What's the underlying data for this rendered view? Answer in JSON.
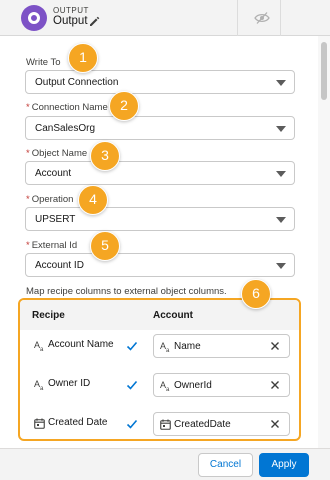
{
  "header": {
    "subtitle": "OUTPUT",
    "title": "Output",
    "icons": [
      "output-node-icon",
      "pencil-icon",
      "eye-hidden-icon"
    ]
  },
  "form": {
    "write_to": {
      "label": "Write To",
      "value": "Output Connection",
      "required": false
    },
    "connection_name": {
      "label": "Connection Name",
      "value": "CanSalesOrg",
      "required": true
    },
    "object_name": {
      "label": "Object Name",
      "value": "Account",
      "required": true
    },
    "operation": {
      "label": "Operation",
      "value": "UPSERT",
      "required": true
    },
    "external_id": {
      "label": "External Id",
      "value": "Account ID",
      "required": true
    },
    "required_marker": "*"
  },
  "badges": [
    "1",
    "2",
    "3",
    "4",
    "5",
    "6"
  ],
  "mapping": {
    "instruction": "Map recipe columns to external object columns.",
    "col_recipe": "Recipe",
    "col_target": "Account",
    "type_text_glyph": "A",
    "rows": [
      {
        "source": "Account Name",
        "source_type": "text",
        "target": "Name",
        "target_type": "text"
      },
      {
        "source": "Owner ID",
        "source_type": "text",
        "target": "OwnerId",
        "target_type": "text"
      },
      {
        "source": "Created Date",
        "source_type": "date",
        "target": "CreatedDate",
        "target_type": "date"
      }
    ]
  },
  "footer": {
    "cancel": "Cancel",
    "apply": "Apply"
  },
  "colors": {
    "accent": "#0176d3",
    "badge": "#f5a623",
    "node_icon": "#7d52c6",
    "required": "#c23934"
  }
}
